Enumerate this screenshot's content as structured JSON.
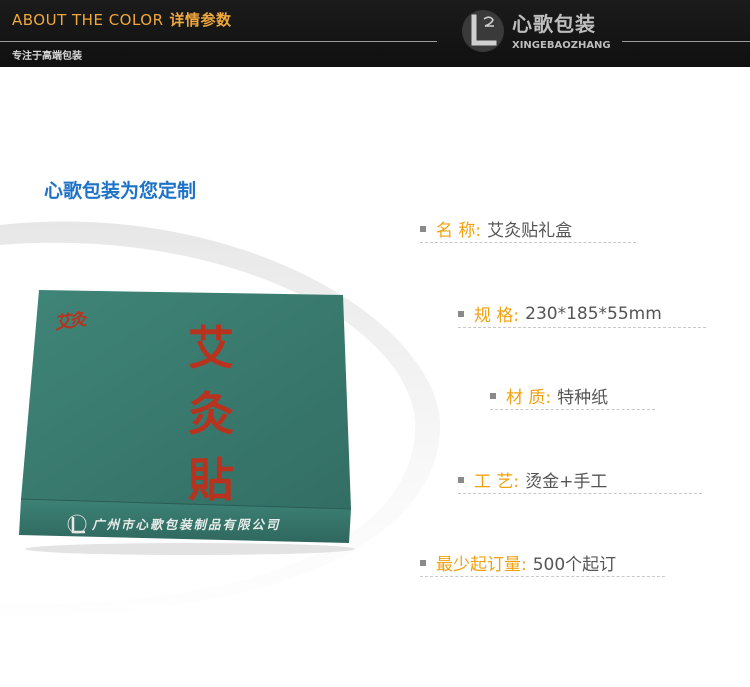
{
  "header": {
    "title_en": "ABOUT THE COLOR",
    "title_cn": "详情参数",
    "subtitle": "专注于高端包装",
    "logo_cn": "心歌包装",
    "logo_en": "XINGEBAOZHANG"
  },
  "tagline": "心歌包装为您定制",
  "product_box": {
    "corner_mark": "艾灸",
    "main_text": [
      "艾",
      "灸",
      "貼"
    ],
    "company": "广州市心歌包装制品有限公司"
  },
  "specs": [
    {
      "label": "名 称:",
      "value": "艾灸贴礼盒"
    },
    {
      "label": "规 格:",
      "value": "230*185*55mm"
    },
    {
      "label": "材 质:",
      "value": "特种纸"
    },
    {
      "label": "工 艺:",
      "value": "烫金+手工"
    },
    {
      "label": "最少起订量:",
      "value": "500个起订"
    }
  ],
  "colors": {
    "header_bg": "#151515",
    "accent_orange": "#f0a10e",
    "tagline_blue": "#1e73c8",
    "box_green": "#3a7c72",
    "foil_red": "#b8321e"
  }
}
